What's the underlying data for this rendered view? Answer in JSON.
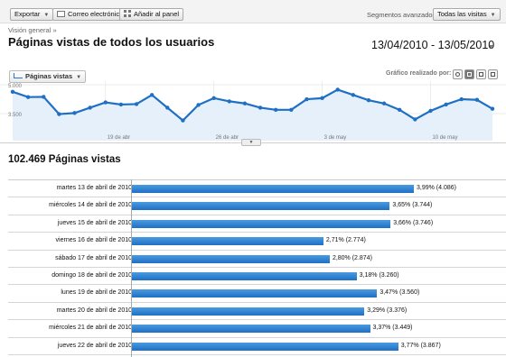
{
  "toolbar": {
    "export_label": "Exportar",
    "email_label": "Correo electrónico",
    "dashboard_label": "Añadir al panel",
    "segments_label": "Segmentos avanzados:",
    "segments_value": "Todas las visitas"
  },
  "breadcrumb": "Visión general »",
  "page_title": "Páginas vistas de todos los usuarios",
  "date_range": "13/04/2010 - 13/05/2010",
  "graph": {
    "metric_label": "Páginas vistas",
    "graph_by_label": "Gráfico realizado por:"
  },
  "chart_data": {
    "type": "line",
    "y_tick_labels": [
      "5.000",
      "3.500"
    ],
    "ylim": [
      2500,
      5300
    ],
    "x_tick_labels": [
      "19 de abr",
      "26 de abr",
      "3 de may",
      "10 de may"
    ],
    "x_tick_indices": [
      6,
      13,
      20,
      27
    ],
    "series": [
      {
        "values": [
          4800,
          4550,
          4560,
          3750,
          3800,
          4050,
          4300,
          4200,
          4220,
          4650,
          4050,
          3450,
          4180,
          4500,
          4350,
          4250,
          4050,
          3950,
          3950,
          4450,
          4500,
          4900,
          4650,
          4400,
          4250,
          3950,
          3500,
          3900,
          4200,
          4450,
          4420,
          4000
        ],
        "color": "#1f6fc4"
      }
    ]
  },
  "total_label": "102.469 Páginas vistas",
  "table": {
    "rows": [
      {
        "date": "martes 13 de abril de 2010",
        "value": "3,99% (4.086)",
        "pct": 3.99
      },
      {
        "date": "miércoles 14 de abril de 2010",
        "value": "3,65% (3.744)",
        "pct": 3.65
      },
      {
        "date": "jueves 15 de abril de 2010",
        "value": "3,66% (3.746)",
        "pct": 3.66
      },
      {
        "date": "viernes 16 de abril de 2010",
        "value": "2,71% (2.774)",
        "pct": 2.71
      },
      {
        "date": "sábado 17 de abril de 2010",
        "value": "2,80% (2.874)",
        "pct": 2.8
      },
      {
        "date": "domingo 18 de abril de 2010",
        "value": "3,18% (3.260)",
        "pct": 3.18
      },
      {
        "date": "lunes 19 de abril de 2010",
        "value": "3,47% (3.560)",
        "pct": 3.47
      },
      {
        "date": "martes 20 de abril de 2010",
        "value": "3,29% (3.376)",
        "pct": 3.29
      },
      {
        "date": "miércoles 21 de abril de 2010",
        "value": "3,37% (3.449)",
        "pct": 3.37
      },
      {
        "date": "jueves 22 de abril de 2010",
        "value": "3,77% (3.867)",
        "pct": 3.77
      }
    ]
  }
}
